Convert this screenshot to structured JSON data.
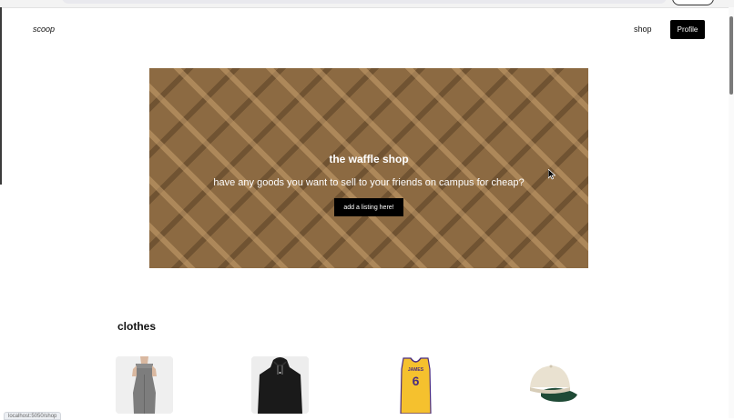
{
  "nav": {
    "brand": "scoop",
    "shop_link": "shop",
    "profile_button": "Profile"
  },
  "hero": {
    "title": "the waffle shop",
    "subtitle": "have any goods you want to sell to your friends on campus for cheap?",
    "cta_label": "add a listing here!",
    "background_color": "#8c6a42"
  },
  "sections": [
    {
      "title": "clothes",
      "items": [
        {
          "icon": "gray-dress-image"
        },
        {
          "icon": "black-hoodie-image"
        },
        {
          "icon": "yellow-jersey-image",
          "jersey_name": "JAMES",
          "jersey_number": "6"
        },
        {
          "icon": "baseball-cap-image"
        }
      ]
    }
  ],
  "status_bar": {
    "url": "localhost:5050/shop"
  }
}
